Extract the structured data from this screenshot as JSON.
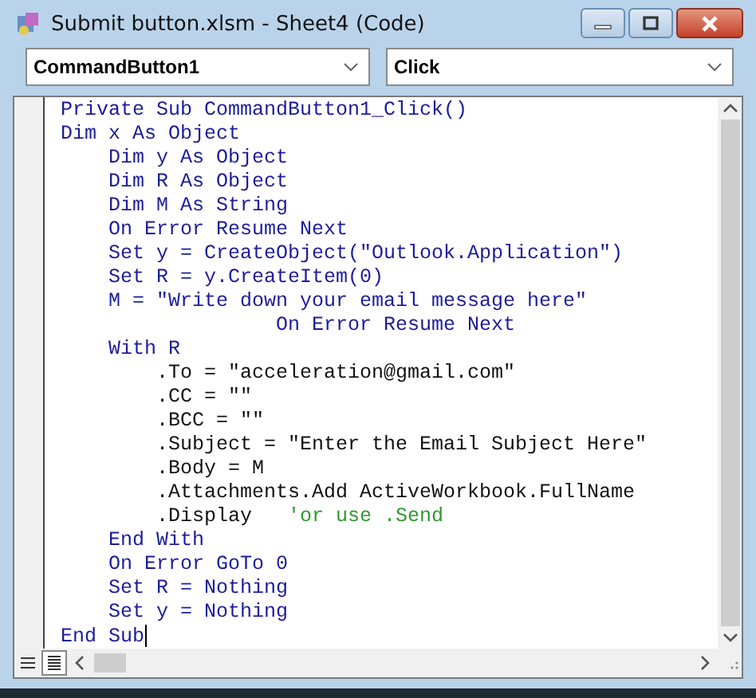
{
  "window": {
    "title": "Submit button.xlsm - Sheet4 (Code)"
  },
  "object_dropdown": {
    "value": "CommandButton1"
  },
  "procedure_dropdown": {
    "value": "Click"
  },
  "code_lines": [
    [
      {
        "text": "Private Sub CommandButton1_Click()",
        "kind": "keyword"
      }
    ],
    [
      {
        "text": "Dim x As Object",
        "kind": "keyword"
      }
    ],
    [
      {
        "text": "    Dim y As Object",
        "kind": "keyword"
      }
    ],
    [
      {
        "text": "    Dim R As Object",
        "kind": "keyword"
      }
    ],
    [
      {
        "text": "    Dim M As String",
        "kind": "keyword"
      }
    ],
    [
      {
        "text": "    On Error Resume Next",
        "kind": "keyword"
      }
    ],
    [
      {
        "text": "    Set y = CreateObject(\"Outlook.Application\")",
        "kind": "keyword"
      }
    ],
    [
      {
        "text": "    Set R = y.CreateItem(0)",
        "kind": "keyword"
      }
    ],
    [
      {
        "text": "    M = \"Write down your email message here\"",
        "kind": "keyword"
      }
    ],
    [
      {
        "text": "                  On Error Resume Next",
        "kind": "keyword"
      }
    ],
    [
      {
        "text": "    With R",
        "kind": "keyword"
      }
    ],
    [
      {
        "text": "        .To = \"acceleration@gmail.com\"",
        "kind": "plain"
      }
    ],
    [
      {
        "text": "        .CC = \"\"",
        "kind": "plain"
      }
    ],
    [
      {
        "text": "        .BCC = \"\"",
        "kind": "plain"
      }
    ],
    [
      {
        "text": "        .Subject = \"Enter the Email Subject Here\"",
        "kind": "plain"
      }
    ],
    [
      {
        "text": "        .Body = M",
        "kind": "plain"
      }
    ],
    [
      {
        "text": "        .Attachments.Add ActiveWorkbook.FullName",
        "kind": "plain"
      }
    ],
    [
      {
        "text": "        .Display   ",
        "kind": "plain"
      },
      {
        "text": "'or use .Send",
        "kind": "comment"
      }
    ],
    [
      {
        "text": "    End With",
        "kind": "keyword"
      }
    ],
    [
      {
        "text": "    On Error GoTo 0",
        "kind": "keyword"
      }
    ],
    [
      {
        "text": "    Set R = Nothing",
        "kind": "keyword"
      }
    ],
    [
      {
        "text": "    Set y = Nothing",
        "kind": "keyword"
      }
    ],
    [
      {
        "text": "End Sub",
        "kind": "keyword"
      }
    ]
  ]
}
